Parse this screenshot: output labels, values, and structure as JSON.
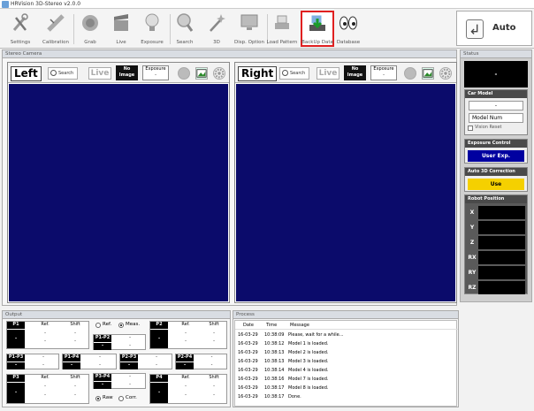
{
  "app": {
    "title": "HRVision 3D-Stereo v2.0.0"
  },
  "toolbar": {
    "items": [
      {
        "label": "Settings"
      },
      {
        "label": "Calibration"
      },
      {
        "label": "Grab"
      },
      {
        "label": "Live"
      },
      {
        "label": "Exposure"
      },
      {
        "label": "Search"
      },
      {
        "label": "3D"
      },
      {
        "label": "Disp. Option"
      },
      {
        "label": "Load Pattern"
      },
      {
        "label": "BackUp Data"
      },
      {
        "label": "Database"
      }
    ],
    "selected": "BackUp Data",
    "auto_label": "Auto"
  },
  "stereo": {
    "title": "Stereo Camera",
    "left": {
      "label": "Left",
      "search": "Search",
      "live": "Live",
      "no_image_1": "No",
      "no_image_2": "Image",
      "exposure_label": "Exposure",
      "exposure_value": "-"
    },
    "right": {
      "label": "Right",
      "search": "Search",
      "live": "Live",
      "no_image_1": "No",
      "no_image_2": "Image",
      "exposure_label": "Exposure",
      "exposure_value": "-"
    },
    "view_color": "#0b0b6b"
  },
  "status": {
    "title": "Status",
    "top_value": "-",
    "car_model": {
      "title": "Car Model",
      "value": "-",
      "model_num": "Model Num",
      "vision_reset": "Vision Reset"
    },
    "exposure_control": {
      "title": "Exposure Control",
      "button": "User Exp."
    },
    "auto3d": {
      "title": "Auto 3D Correction",
      "button": "Use"
    },
    "robot_position": {
      "title": "Robot Position",
      "axes": [
        "X",
        "Y",
        "Z",
        "RX",
        "RY",
        "RZ"
      ]
    }
  },
  "output": {
    "title": "Output",
    "ref": "Ref.",
    "shift": "Shift",
    "dash": "-",
    "radio_ref": "Ref.",
    "radio_meas": "Meas.",
    "radio_raw": "Raw",
    "radio_corr": "Corr.",
    "p1": "P1",
    "p2": "P2",
    "p3": "P3",
    "p4": "P4",
    "p1p2": "P1-P2",
    "p3p4": "P3-P4",
    "p1p3": "P1-P3",
    "p1p4": "P1-P4",
    "p2p3": "P2-P3",
    "p2p4": "P2-P4"
  },
  "process": {
    "title": "Process",
    "columns": [
      "Date",
      "Time",
      "Message"
    ],
    "rows": [
      [
        "16-03-29",
        "10:38:09",
        "Please, wait for a while..."
      ],
      [
        "16-03-29",
        "10:38:12",
        "Model 1 is loaded."
      ],
      [
        "16-03-29",
        "10:38:13",
        "Model 2 is loaded."
      ],
      [
        "16-03-29",
        "10:38:13",
        "Model 3 is loaded."
      ],
      [
        "16-03-29",
        "10:38:14",
        "Model 4 is loaded."
      ],
      [
        "16-03-29",
        "10:38:16",
        "Model 7 is loaded."
      ],
      [
        "16-03-29",
        "10:38:17",
        "Model 8 is loaded."
      ],
      [
        "16-03-29",
        "10:38:17",
        "Done."
      ]
    ]
  },
  "colors": {
    "exposure_button": "#0000a0",
    "use_button": "#f5d000",
    "selected_border": "#e02020"
  }
}
